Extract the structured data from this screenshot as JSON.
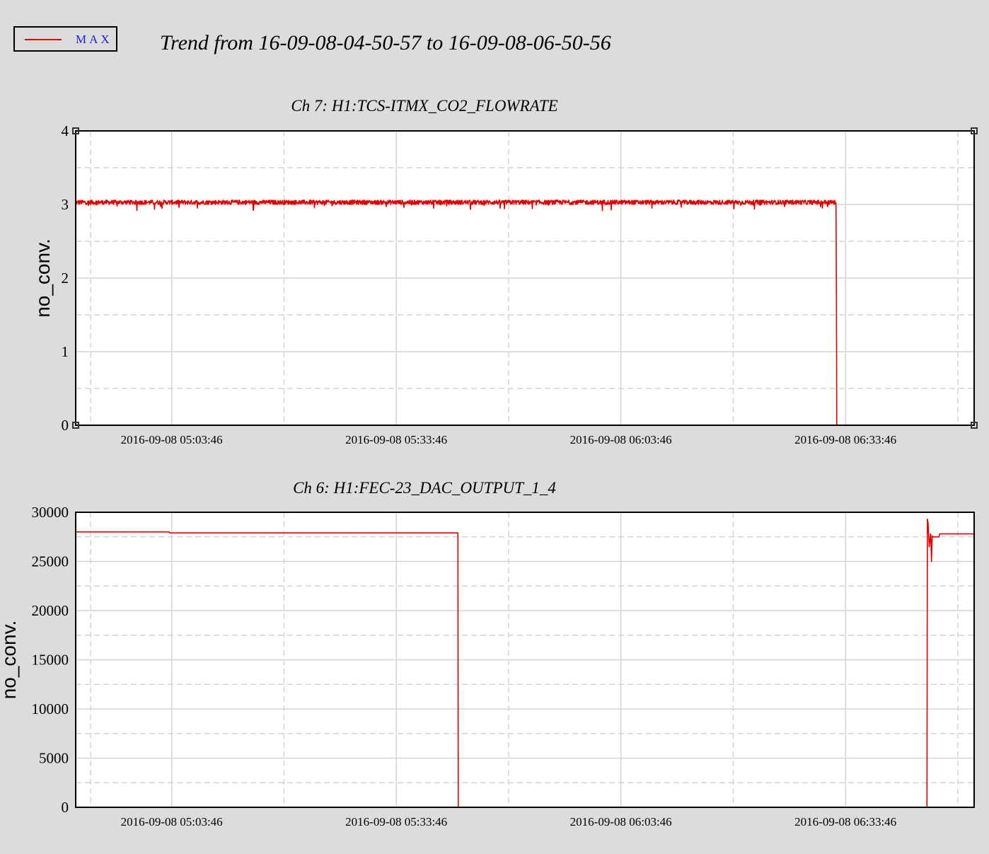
{
  "legend": {
    "label": "MAX",
    "color": "#e00000",
    "text_color": "#1d1dd6"
  },
  "title": "Trend from 16-09-08-04-50-57 to 16-09-08-06-50-56",
  "chart_data": [
    {
      "type": "line",
      "title": "Ch 7: H1:TCS-ITMX_CO2_FLOWRATE",
      "ylabel": "no_conv.",
      "xlabel": "",
      "xlim": [
        0,
        120
      ],
      "ylim": [
        0,
        4
      ],
      "yticks": [
        0,
        1,
        2,
        3,
        4
      ],
      "yticklabels": [
        "0",
        "1",
        "2",
        "3",
        "4"
      ],
      "xticks": [
        12.82,
        42.82,
        72.82,
        102.82
      ],
      "xticklabels": [
        "2016-09-08 05:03:46",
        "2016-09-08 05:33:46",
        "2016-09-08 06:03:46",
        "2016-09-08 06:33:46"
      ],
      "grid": true,
      "series": [
        {
          "name": "MAX",
          "color": "#e00000",
          "noise": 0.03,
          "x": [
            0,
            101.5,
            101.55,
            101.6,
            101.65,
            117.8
          ],
          "y": [
            3.03,
            3.03,
            3.02,
            1.85,
            0.0,
            0.0
          ]
        }
      ]
    },
    {
      "type": "line",
      "title": "Ch 6: H1:FEC-23_DAC_OUTPUT_1_4",
      "ylabel": "no_conv.",
      "xlabel": "",
      "xlim": [
        0,
        120
      ],
      "ylim": [
        0,
        30000
      ],
      "yticks": [
        0,
        5000,
        10000,
        15000,
        20000,
        25000,
        30000
      ],
      "yticklabels": [
        "0",
        "5000",
        "10000",
        "15000",
        "20000",
        "25000",
        "30000"
      ],
      "xticks": [
        12.82,
        42.82,
        72.82,
        102.82
      ],
      "xticklabels": [
        "2016-09-08 05:03:46",
        "2016-09-08 05:33:46",
        "2016-09-08 06:03:46",
        "2016-09-08 06:33:46"
      ],
      "grid": true,
      "series": [
        {
          "name": "MAX",
          "color": "#e00000",
          "noise": 0,
          "x": [
            0,
            12.5,
            12.6,
            51.0,
            51.05,
            51.1,
            113.7,
            113.75,
            113.85,
            114.0,
            114.1,
            114.2,
            114.3,
            114.4,
            114.5,
            115.3,
            115.4,
            120
          ],
          "y": [
            28000,
            28000,
            27900,
            27900,
            27900,
            0,
            0,
            29300,
            28900,
            26500,
            27300,
            27800,
            25000,
            27600,
            27500,
            27500,
            27800,
            27800
          ]
        }
      ]
    }
  ]
}
